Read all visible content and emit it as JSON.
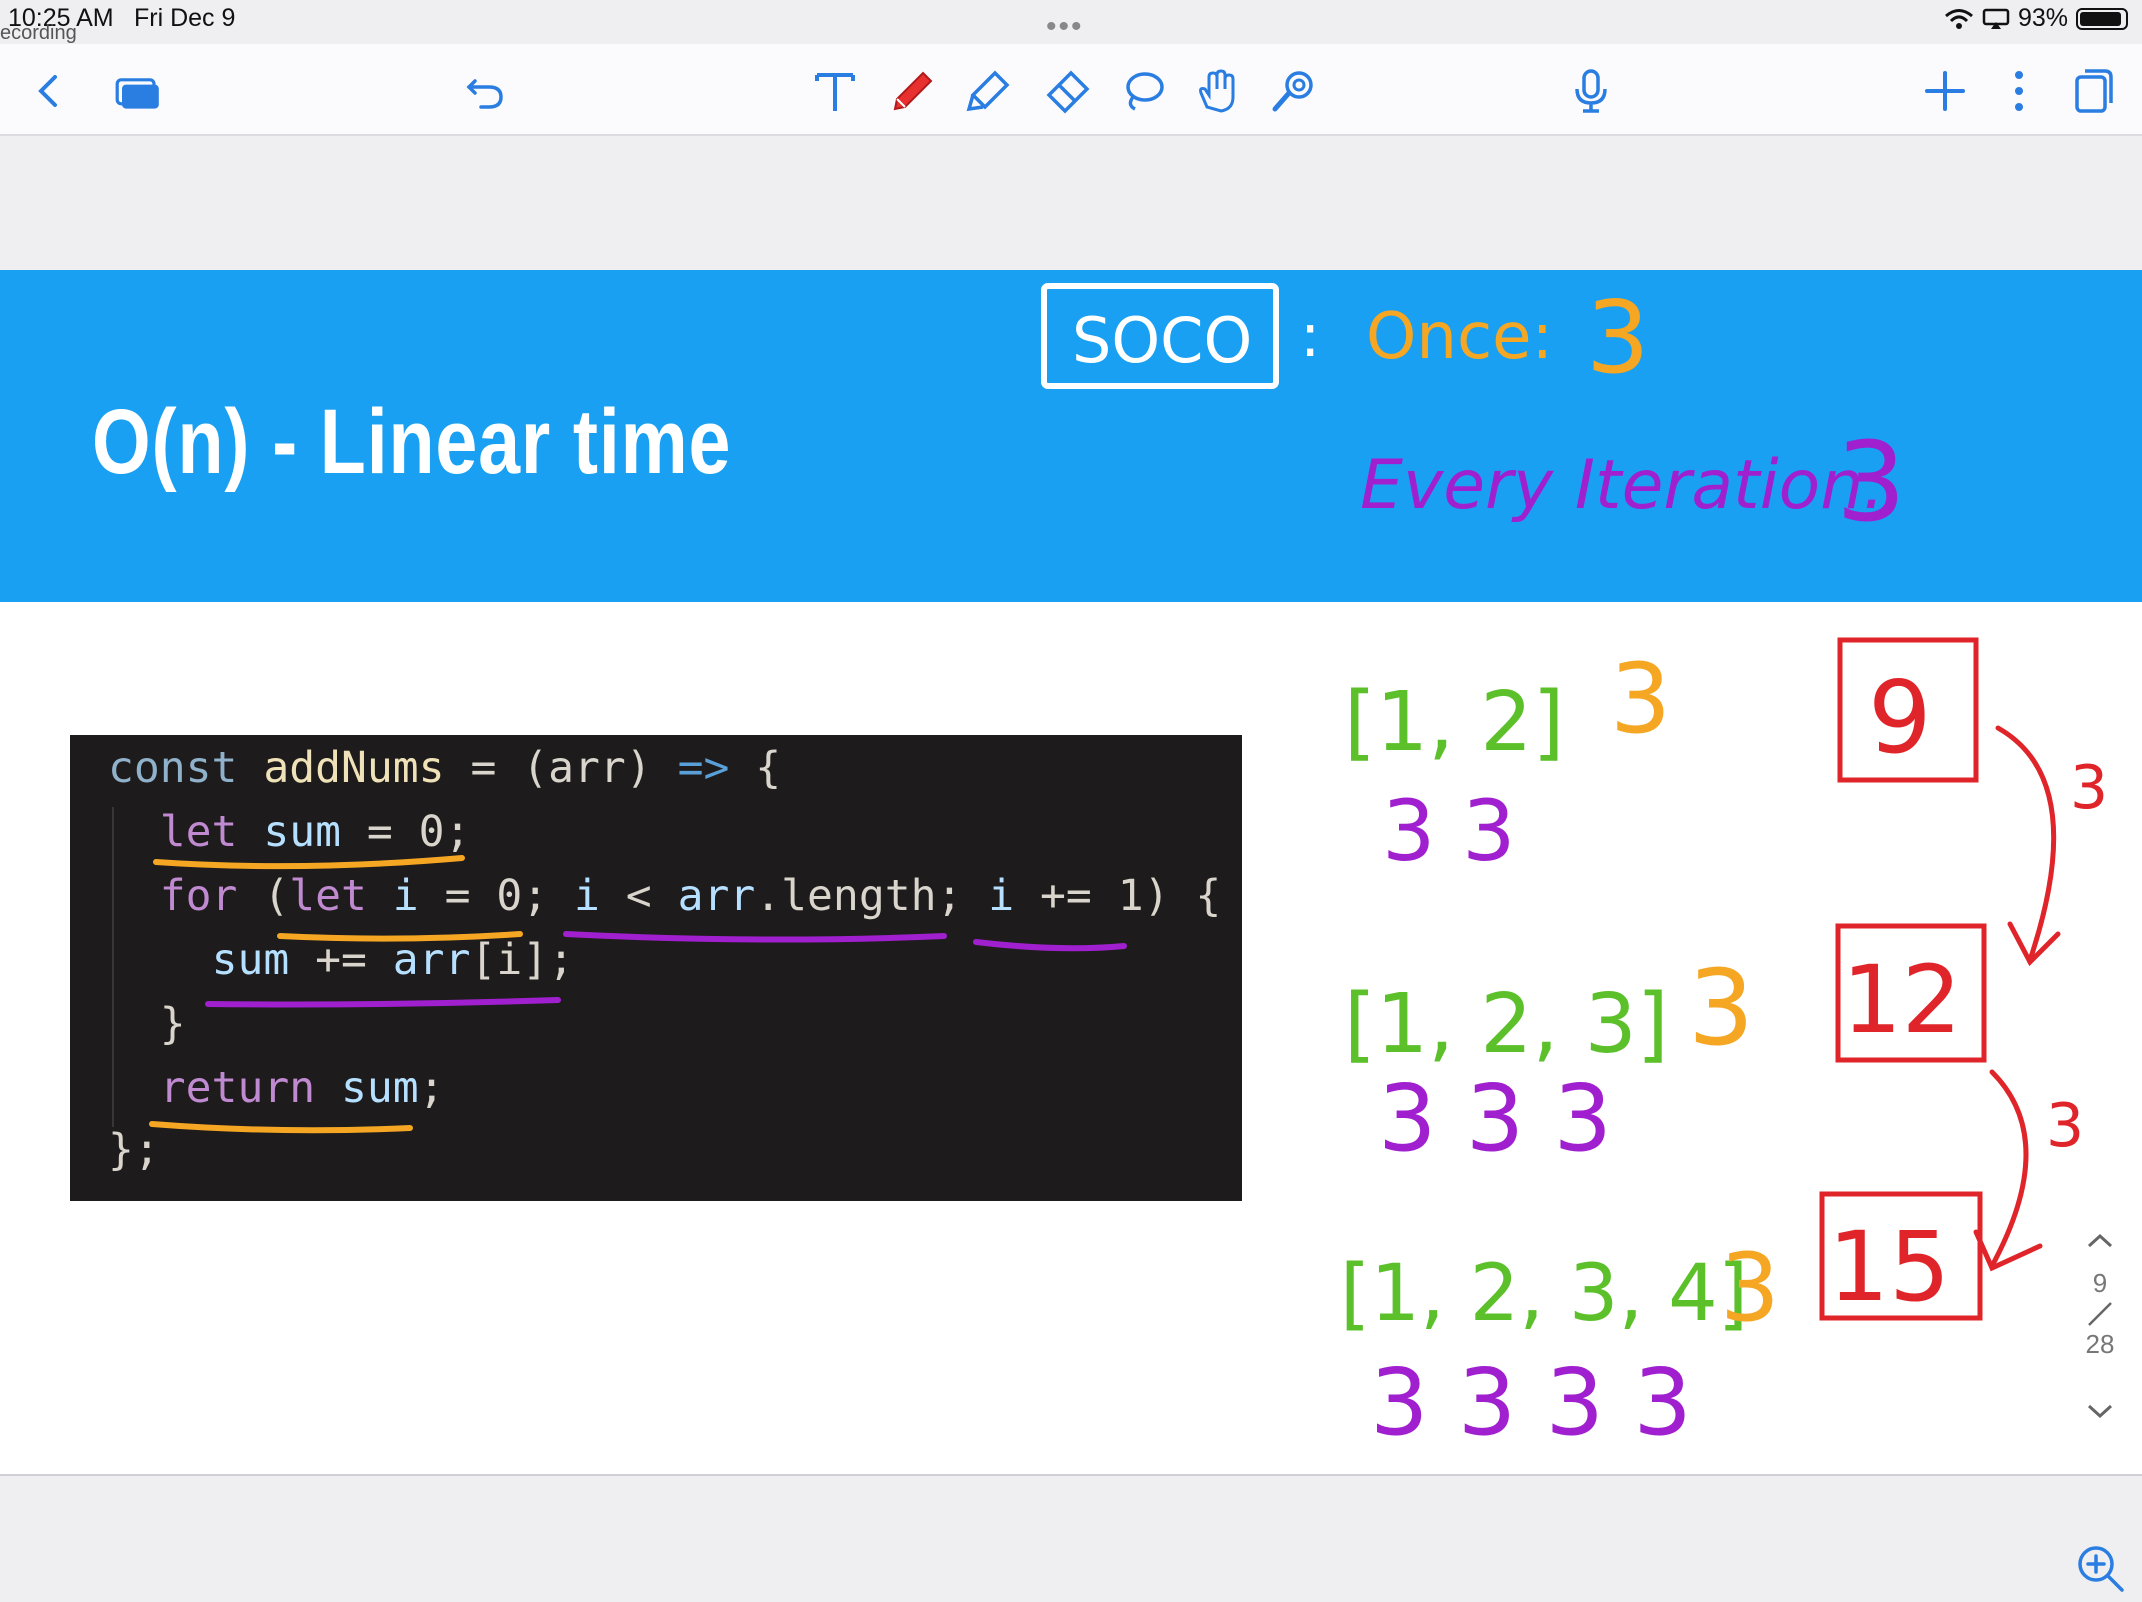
{
  "status_bar": {
    "time": "10:25 AM",
    "date": "Fri Dec 9",
    "recording_label": "ecording",
    "battery": "93%",
    "battery_level": 0.93
  },
  "toolbar": {
    "icons": [
      "back-icon",
      "thumbnails-icon",
      "undo-icon",
      "text-tool-icon",
      "pen-icon",
      "highlighter-icon",
      "eraser-icon",
      "lasso-icon",
      "hand-icon",
      "laser-pointer-icon",
      "microphone-icon",
      "add-icon",
      "more-icon",
      "pages-icon"
    ],
    "active_tool": "pen",
    "pen_color": "#e8302f"
  },
  "slide": {
    "title": "O(n) - Linear time",
    "banner_color": "#1aa0f2",
    "code": [
      "const addNums = (arr) => {",
      "  let sum = 0;",
      "  for (let i = 0; i < arr.length; i += 1) {",
      "    sum += arr[i];",
      "  }",
      "  return sum;",
      "};"
    ]
  },
  "annotations": {
    "soco_label": "SOCO",
    "once_label": "Once:",
    "once_value": "3",
    "every_label": "Every Iteration:",
    "every_value": "3",
    "rows": [
      {
        "array": "[1, 2]",
        "once": "3",
        "iterations": "3 3",
        "total": "9"
      },
      {
        "array": "[1, 2, 3]",
        "once": "3",
        "iterations": "3 3 3",
        "total": "12"
      },
      {
        "array": "[1, 2, 3, 4]",
        "once": "3",
        "iterations": "3 3 3 3",
        "total": "15"
      }
    ],
    "arrow_labels": [
      "3",
      "3"
    ],
    "colors": {
      "orange": "#f5a623",
      "purple": "#a020d0",
      "green": "#5cc02a",
      "red": "#e0252a"
    }
  },
  "pager": {
    "current": "9",
    "total": "28"
  }
}
